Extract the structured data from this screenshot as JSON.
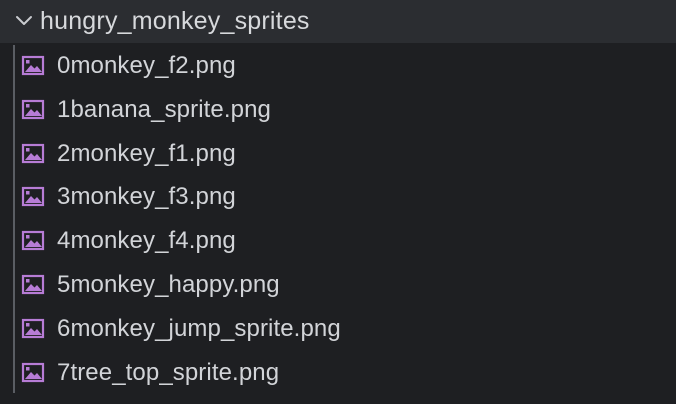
{
  "folder": {
    "name": "hungry_monkey_sprites",
    "expanded": true,
    "icon": "chevron-down-icon"
  },
  "files": [
    {
      "name": "0monkey_f2.png",
      "icon": "image-file-icon"
    },
    {
      "name": "1banana_sprite.png",
      "icon": "image-file-icon"
    },
    {
      "name": "2monkey_f1.png",
      "icon": "image-file-icon"
    },
    {
      "name": "3monkey_f3.png",
      "icon": "image-file-icon"
    },
    {
      "name": "4monkey_f4.png",
      "icon": "image-file-icon"
    },
    {
      "name": "5monkey_happy.png",
      "icon": "image-file-icon"
    },
    {
      "name": "6monkey_jump_sprite.png",
      "icon": "image-file-icon"
    },
    {
      "name": "7tree_top_sprite.png",
      "icon": "image-file-icon"
    }
  ],
  "colors": {
    "background": "#1e1f22",
    "header_background": "#2b2d31",
    "text": "#d2d4d8",
    "icon_accent": "#b77cd6",
    "indent_guide": "#5a5d63"
  }
}
